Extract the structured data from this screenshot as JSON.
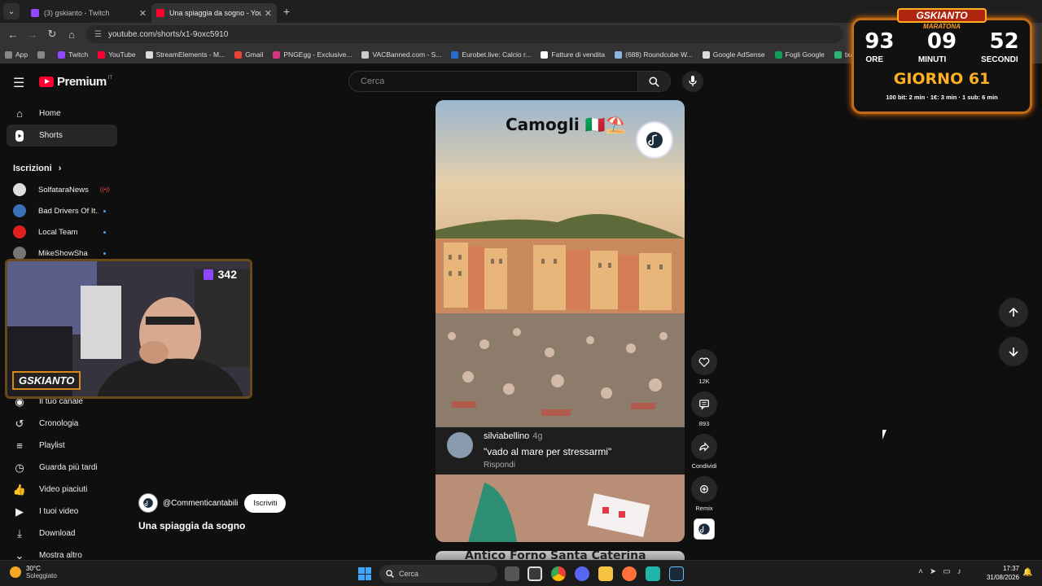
{
  "browser": {
    "tabs": [
      {
        "title": "(3) gskianto - Twitch",
        "color": "#9146ff",
        "active": false
      },
      {
        "title": "Una spiaggia da sogno - YouTu",
        "color": "#ff0033",
        "active": true
      }
    ],
    "url": "youtube.com/shorts/x1-9oxc5910",
    "bookmarks": [
      {
        "label": "App",
        "color": "#888888"
      },
      {
        "label": "",
        "color": "#888888"
      },
      {
        "label": "Twitch",
        "color": "#9146ff"
      },
      {
        "label": "YouTube",
        "color": "#ff0033"
      },
      {
        "label": "StreamElements - M...",
        "color": "#dddddd"
      },
      {
        "label": "Gmail",
        "color": "#ea4335"
      },
      {
        "label": "PNGEgg - Exclusive...",
        "color": "#d63384"
      },
      {
        "label": "VACBanned.com - S...",
        "color": "#cccccc"
      },
      {
        "label": "Eurobet.live: Calcio r...",
        "color": "#2a6bd1"
      },
      {
        "label": "Fatture di vendita",
        "color": "#ffffff"
      },
      {
        "label": "(688) Roundcube W...",
        "color": "#8fb3e0"
      },
      {
        "label": "Google AdSense",
        "color": "#dddddd"
      },
      {
        "label": "Fogli Google",
        "color": "#0f9d58"
      },
      {
        "label": "txAdmin",
        "color": "#2bb673"
      }
    ]
  },
  "youtube": {
    "logo": "Premium",
    "country": "IT",
    "search_placeholder": "Cerca",
    "nav": [
      {
        "label": "Home",
        "icon": "home-icon",
        "active": false
      },
      {
        "label": "Shorts",
        "icon": "shorts-icon",
        "active": true
      }
    ],
    "subscriptions_title": "Iscrizioni",
    "subscriptions": [
      {
        "name": "SolfataraNews",
        "color": "#dddddd",
        "live": true
      },
      {
        "name": "Bad Drivers Of It...",
        "color": "#3b6fb6",
        "live": false
      },
      {
        "name": "Local Team",
        "color": "#e02020",
        "live": false
      },
      {
        "name": "MikeShowSha",
        "color": "#777777",
        "live": false
      }
    ],
    "you_items": [
      {
        "label": "Il tuo canale",
        "icon": "channel-icon"
      },
      {
        "label": "Cronologia",
        "icon": "history-icon"
      },
      {
        "label": "Playlist",
        "icon": "playlist-icon"
      },
      {
        "label": "Guarda più tardi",
        "icon": "watch-later-icon"
      },
      {
        "label": "Video piaciuti",
        "icon": "like-icon"
      },
      {
        "label": "I tuoi video",
        "icon": "your-videos-icon"
      },
      {
        "label": "Download",
        "icon": "download-icon"
      },
      {
        "label": "Mostra altro",
        "icon": "chevron-down-icon"
      }
    ],
    "short": {
      "overlay_title": "Camogli 🇮🇹⛱️",
      "comment": {
        "user": "silviabellino",
        "age": "4g",
        "text": "\"vado al mare per stressarmi\"",
        "reply": "Rispondi"
      },
      "channel": "@Commenticantabili",
      "subscribe": "Iscriviti",
      "title": "Una spiaggia da sogno",
      "next_title": "Antico Forno Santa Caterina"
    },
    "actions": [
      {
        "label": "12K",
        "icon": "like-icon"
      },
      {
        "label": "893",
        "icon": "comment-icon"
      },
      {
        "label": "Condividi",
        "icon": "share-icon"
      },
      {
        "label": "Remix",
        "icon": "remix-icon"
      }
    ]
  },
  "stream": {
    "viewers": "342",
    "name_tag": "GSKIANTO",
    "timer": {
      "brand": "GSKIANTO",
      "subtitle": "MARATONA",
      "hours": "93",
      "minutes": "09",
      "seconds": "52",
      "label_hours": "ORE",
      "label_minutes": "MINUTI",
      "label_seconds": "SECONDI",
      "day": "GIORNO 61",
      "rules": "100 bit: 2 min · 1€: 3 min · 1 sub: 6 min"
    }
  },
  "taskbar": {
    "temp": "30°C",
    "weather": "Soleggiato",
    "search": "Cerca",
    "time": "17:37",
    "date": "31/08/2026"
  }
}
